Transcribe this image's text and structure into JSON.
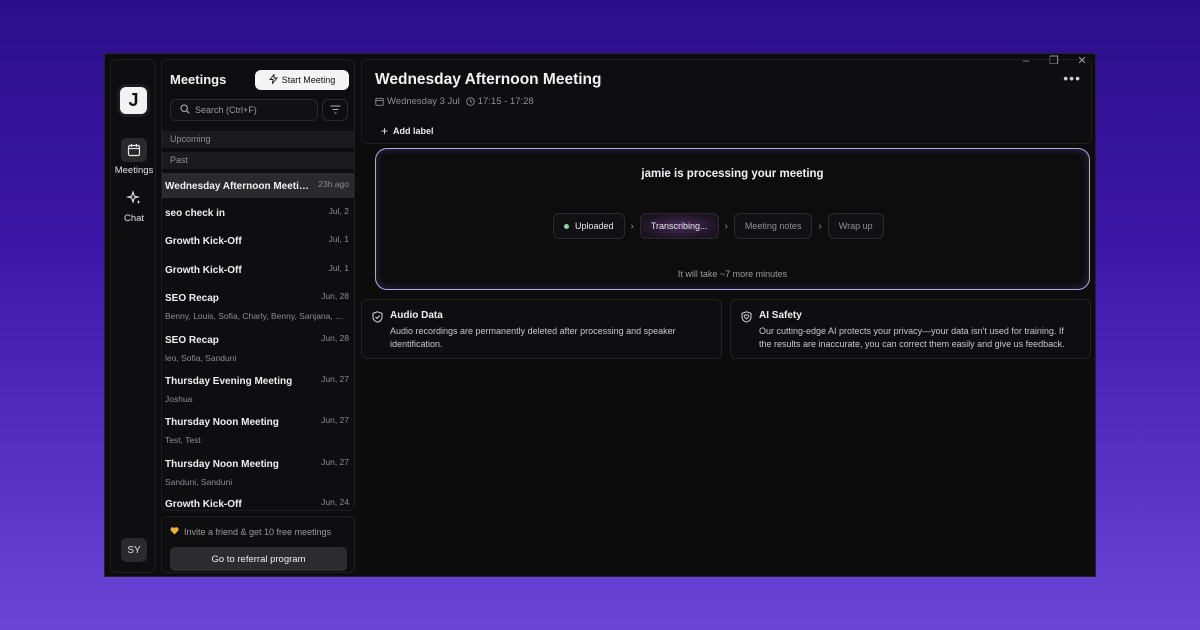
{
  "window_controls": [
    "–",
    "❐",
    "✕"
  ],
  "rail": {
    "logo": "J",
    "items": [
      {
        "label": "Meetings",
        "icon": "calendar-icon"
      },
      {
        "label": "Chat",
        "icon": "sparkle-icon"
      }
    ],
    "avatar": "SY"
  },
  "list": {
    "title": "Meetings",
    "start_button": "Start Meeting",
    "search_placeholder": "Search (Ctrl+F)",
    "sections": {
      "upcoming": "Upcoming",
      "past": "Past"
    },
    "items": [
      {
        "title": "Wednesday Afternoon Meeting",
        "date": "23h ago",
        "sub": ""
      },
      {
        "title": "seo check in",
        "date": "Jul, 2",
        "sub": ""
      },
      {
        "title": "Growth Kick-Off",
        "date": "Jul, 1",
        "sub": ""
      },
      {
        "title": "Growth Kick-Off",
        "date": "Jul, 1",
        "sub": ""
      },
      {
        "title": "SEO Recap",
        "date": "Jun, 28",
        "sub": "Benny, Louis, Sofia, Charly, Benny, Sanjana, ..."
      },
      {
        "title": "SEO Recap",
        "date": "Jun, 28",
        "sub": "leo, Sofia, Sanduni"
      },
      {
        "title": "Thursday Evening Meeting",
        "date": "Jun, 27",
        "sub": "Joshua"
      },
      {
        "title": "Thursday Noon Meeting",
        "date": "Jun, 27",
        "sub": "Test, Test"
      },
      {
        "title": "Thursday Noon Meeting",
        "date": "Jun, 27",
        "sub": "Sanduni, Sanduni"
      },
      {
        "title": "Growth Kick-Off",
        "date": "Jun, 24",
        "sub": ""
      }
    ],
    "referral_text": "Invite a friend & get 10 free meetings",
    "referral_button": "Go to referral program"
  },
  "meeting": {
    "title": "Wednesday Afternoon Meeting",
    "date": "Wednesday 3 Jul",
    "time": "17:15 - 17:28",
    "add_label": "Add label",
    "processing_title": "jamie is processing your meeting",
    "steps": [
      {
        "label": "Uploaded",
        "state": "done"
      },
      {
        "label": "Transcribing...",
        "state": "active"
      },
      {
        "label": "Meeting notes",
        "state": "pending"
      },
      {
        "label": "Wrap up",
        "state": "pending"
      }
    ],
    "eta": "It will take ~7 more minutes"
  },
  "cards": [
    {
      "title": "Audio Data",
      "body": "Audio recordings are permanently deleted after processing and speaker identification.",
      "icon": "shield-check-icon"
    },
    {
      "title": "AI Safety",
      "body": "Our cutting-edge AI protects your privacy—your data isn't used for training. If the results are inaccurate, you can correct them easily and give us feedback.",
      "icon": "heart-shield-icon"
    }
  ],
  "colors": {
    "accent_border": "#b3a6e8",
    "status_done": "#8fcf9f",
    "background_gradient_top": "#2a0f8a"
  }
}
